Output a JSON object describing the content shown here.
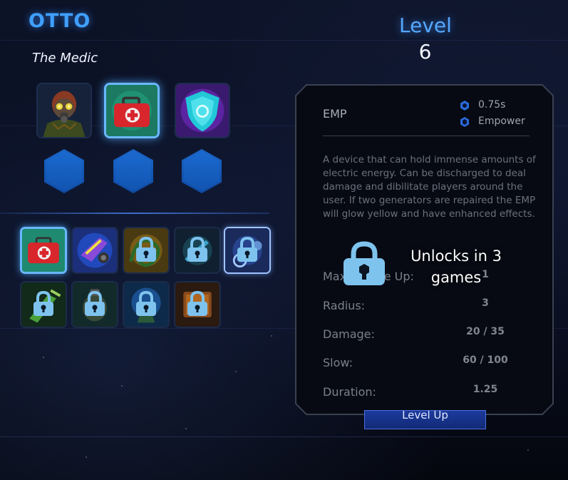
{
  "hero": {
    "name": "OTTO",
    "role": "The Medic"
  },
  "level": {
    "label": "Level",
    "value": "6"
  },
  "portraits": [
    {
      "name": "gas-mask-medic-portrait",
      "selected": false
    },
    {
      "name": "medkit-portrait",
      "selected": true
    },
    {
      "name": "energy-shield-portrait",
      "selected": false
    }
  ],
  "talent_slots": 3,
  "abilities": [
    {
      "name": "medkit-ability-icon",
      "locked": false,
      "selected": true
    },
    {
      "name": "emitter-gun-ability-icon",
      "locked": false
    },
    {
      "name": "coiled-cable-ability-icon",
      "locked": true
    },
    {
      "name": "shock-device-ability-icon",
      "locked": true
    },
    {
      "name": "emp-ability-icon",
      "locked": true,
      "hovered": true
    },
    {
      "name": "green-syringe-ability-icon",
      "locked": true
    },
    {
      "name": "grenade-ability-icon",
      "locked": true
    },
    {
      "name": "tesla-coil-ability-icon",
      "locked": true
    },
    {
      "name": "crate-ability-icon",
      "locked": true
    }
  ],
  "tooltip": {
    "name": "EMP",
    "cooldown": "0.75s",
    "type": "Empower",
    "description": "A device that can hold immense amounts of electric energy. Can be discharged to deal damage and dibilitate players around the user.  If two generators are repaired the EMP will glow yellow and have enhanced effects.",
    "stats": [
      {
        "label": "Max Charge Up:",
        "value": "1"
      },
      {
        "label": "Radius:",
        "value": "3"
      },
      {
        "label": "Damage:",
        "value": "20 / 35"
      },
      {
        "label": "Slow:",
        "value": "60 / 100"
      },
      {
        "label": "Duration:",
        "value": "1.25"
      }
    ]
  },
  "level_up_button": "Level Up",
  "unlock_message": "Unlocks in 3 games",
  "colors": {
    "accent": "#3fa0ff",
    "lock": "#7ec3ee",
    "panel_border": "#3a4150"
  }
}
